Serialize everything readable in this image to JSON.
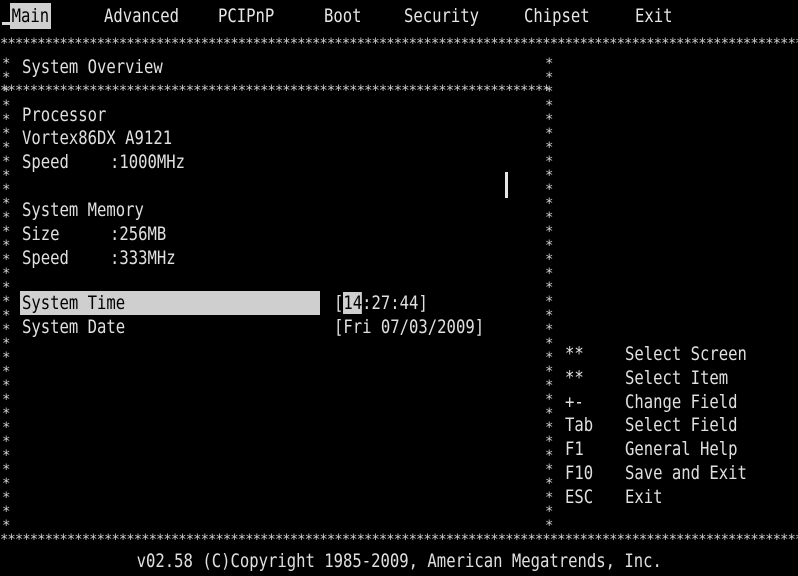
{
  "menu": {
    "tabs": [
      "Main",
      "Advanced",
      "PCIPnP",
      "Boot",
      "Security",
      "Chipset",
      "Exit"
    ]
  },
  "overview": {
    "title": "System Overview",
    "processor_heading": "Processor",
    "processor_model": "Vortex86DX A9121",
    "processor_speed_label": "Speed",
    "processor_speed_value": ":1000MHz",
    "memory_heading": "System Memory",
    "memory_size_label": "Size",
    "memory_size_value": ":256MB",
    "memory_speed_label": "Speed",
    "memory_speed_value": ":333MHz"
  },
  "settings": {
    "time_label": "System Time",
    "time_open": "[",
    "time_hour": "14",
    "time_rest": ":27:44]",
    "date_label": "System Date",
    "date_value": "[Fri 07/03/2009]"
  },
  "help": [
    {
      "key": "**",
      "desc": "Select Screen"
    },
    {
      "key": "**",
      "desc": "Select Item"
    },
    {
      "key": "+-",
      "desc": "Change Field"
    },
    {
      "key": "Tab",
      "desc": "Select Field"
    },
    {
      "key": "F1",
      "desc": "General Help"
    },
    {
      "key": "F10",
      "desc": "Save and Exit"
    },
    {
      "key": "ESC",
      "desc": "Exit"
    }
  ],
  "footer": {
    "copyright": "v02.58 (C)Copyright 1985-2009, American Megatrends, Inc."
  }
}
